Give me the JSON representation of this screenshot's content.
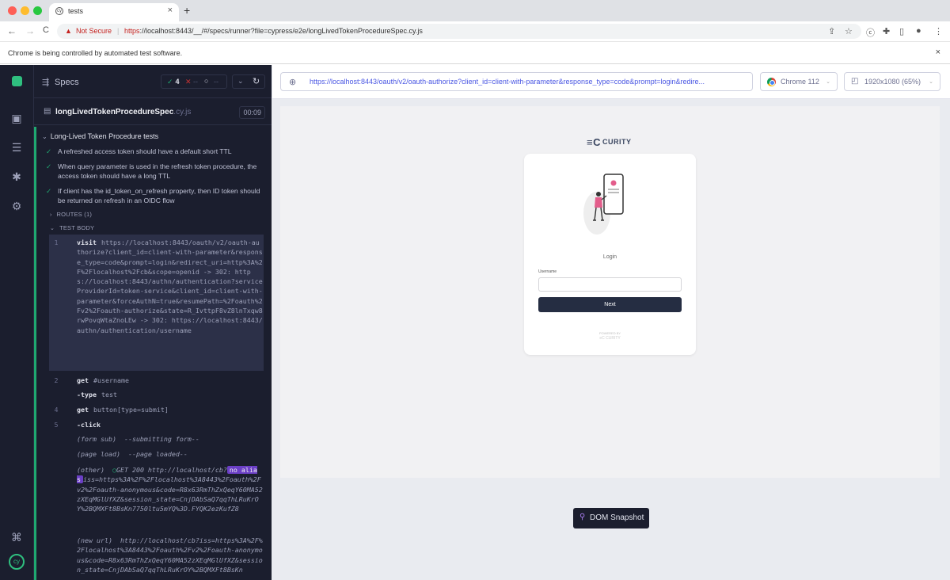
{
  "browser": {
    "tab_title": "tests",
    "new_tab": "+",
    "tab_close": "×",
    "nav_back": "←",
    "nav_forward": "→",
    "nav_reload": "C",
    "security_label": "Not Secure",
    "url_scheme": "https",
    "url_rest": "://localhost:8443/__/#/specs/runner?file=cypress/e2e/longLivedTokenProcedureSpec.cy.js",
    "infobar_text": "Chrome is being controlled by automated test software.",
    "infobar_close": "×"
  },
  "reporter": {
    "specs_label": "Specs",
    "passed_count": "4",
    "failed_placeholder": "--",
    "skipped_placeholder": "--",
    "spec_name": "longLivedTokenProcedureSpec",
    "spec_ext": ".cy.js",
    "duration": "00:09",
    "suite_title": "Long-Lived Token Procedure tests",
    "tests": [
      "A refreshed access token should have a default short TTL",
      "When query parameter is used in the refresh token procedure, the access token should have a long TTL",
      "If client has the id_token_on_refresh property, then ID token should be returned on refresh in an OIDC flow"
    ],
    "routes_label": "ROUTES (1)",
    "test_body_label": "TEST BODY",
    "commands": [
      {
        "num": "1",
        "name": "visit",
        "arg": "https://localhost:8443/oauth/v2/oauth-authorize?client_id=client-with-parameter&response_type=code&prompt=login&redirect_uri=http%3A%2F%2Flocalhost%2Fcb&scope=openid -> 302: https://localhost:8443/authn/authentication?serviceProviderId=token-service&client_id=client-with-parameter&forceAuthN=true&resumePath=%2Foauth%2Fv2%2Foauth-authorize&state=R_IvttpF8vZ8lnTxqw8rwPovqWtaZnoLEw -> 302: https://localhost:8443/authn/authentication/username"
      },
      {
        "num": "2",
        "name": "get",
        "arg": "#username"
      },
      {
        "num": "",
        "name": "-type",
        "arg": "test"
      },
      {
        "num": "4",
        "name": "get",
        "arg": "button[type=submit]"
      },
      {
        "num": "5",
        "name": "-click",
        "arg": ""
      }
    ],
    "events": [
      {
        "label": "(form sub)",
        "text": "--submitting form--"
      },
      {
        "label": "(page load)",
        "text": "--page loaded--"
      }
    ],
    "xhr_label": "(other)",
    "xhr_text": "GET 200 http://localhost/cb?",
    "xhr_badge": "no alias",
    "xhr_rest": "iss=https%3A%2F%2Flocalhost%3A8443%2Foauth%2Fv2%2Foauth-anonymous&code=R8x63RmThZxQeqY60MA52zXEqMGlUfXZ&session_state=CnjDAbSaQ7qqThLRuKrOY%2BQMXFt8BsKn7750ltu5mYQ%3D.FYQK2ezKufZ8",
    "newurl_label": "(new url)",
    "newurl_text": "http://localhost/cb?iss=https%3A%2F%2Flocalhost%3A8443%2Foauth%2Fv2%2Foauth-anonymous&code=R8x63RmThZxQeqY60MA52zXEqMGlUfXZ&session_state=CnjDAbSaQ7qqThLRuKrOY%2BQMXFt8BsKn"
  },
  "preview": {
    "url": "https://localhost:8443/oauth/v2/oauth-authorize?client_id=client-with-parameter&response_type=code&prompt=login&redire...",
    "browser": "Chrome 112",
    "viewport": "1920x1080 (65%)",
    "dom_snapshot": "DOM Snapshot"
  },
  "login_page": {
    "brand": "CURITY",
    "title": "Login",
    "username_label": "Username",
    "username_value": "",
    "next_label": "Next",
    "powered_by": "POWERED BY",
    "powered_brand": "CURITY"
  }
}
